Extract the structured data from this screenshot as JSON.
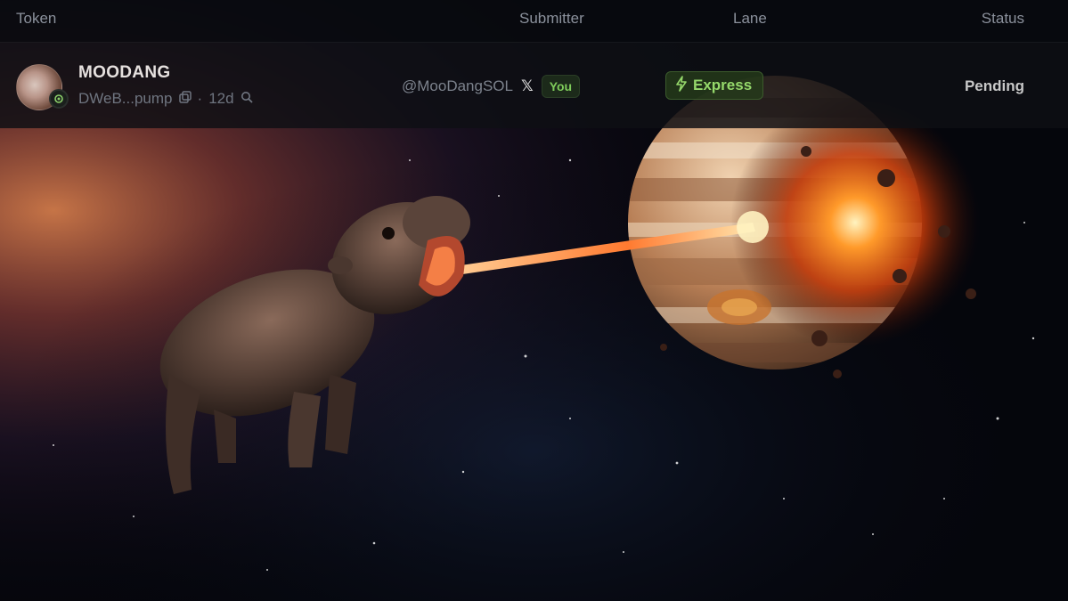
{
  "header": {
    "token_label": "Token",
    "submitter_label": "Submitter",
    "lane_label": "Lane",
    "status_label": "Status"
  },
  "row": {
    "token_name": "MOODANG",
    "token_address": "DWeB...pump",
    "age": "12d",
    "submitter_handle": "@MooDangSOL",
    "you_badge": "You",
    "lane": "Express",
    "status": "Pending"
  },
  "icons": {
    "copy": "copy-icon",
    "search": "search-icon",
    "x": "x-logo-icon",
    "lightning": "lightning-icon",
    "verified": "verified-badge-icon"
  },
  "colors": {
    "express_green": "#95d86b",
    "you_green": "#7ecb5a"
  }
}
